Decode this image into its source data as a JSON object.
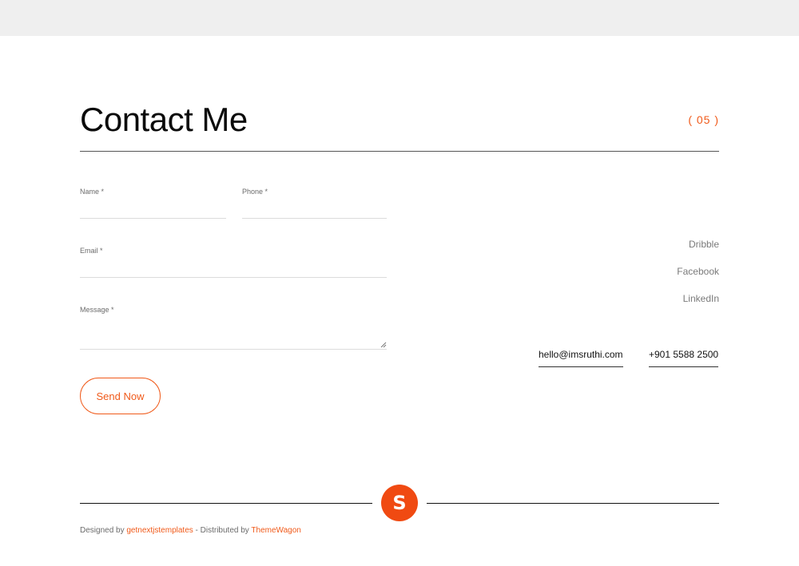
{
  "contact": {
    "title": "Contact Me",
    "section_number": "( 05 )"
  },
  "form": {
    "name_label": "Name *",
    "name_value": "",
    "phone_label": "Phone *",
    "phone_value": "",
    "email_label": "Email *",
    "email_value": "",
    "message_label": "Message *",
    "message_value": "",
    "submit_label": "Send Now"
  },
  "social": {
    "items": [
      {
        "label": "Dribble"
      },
      {
        "label": "Facebook"
      },
      {
        "label": "LinkedIn"
      }
    ]
  },
  "direct": {
    "email": "hello@imsruthi.com",
    "phone": "+901 5588 2500"
  },
  "footer": {
    "logo_letter": "S",
    "designed_by_prefix": "Designed by",
    "designer_link": "getnextjstemplates",
    "distributed_by_prefix": "- Distributed by",
    "distributor_link": "ThemeWagon"
  },
  "colors": {
    "accent": "#f05a1a",
    "logo_bg": "#f04a12",
    "top_bar": "#efefef"
  }
}
